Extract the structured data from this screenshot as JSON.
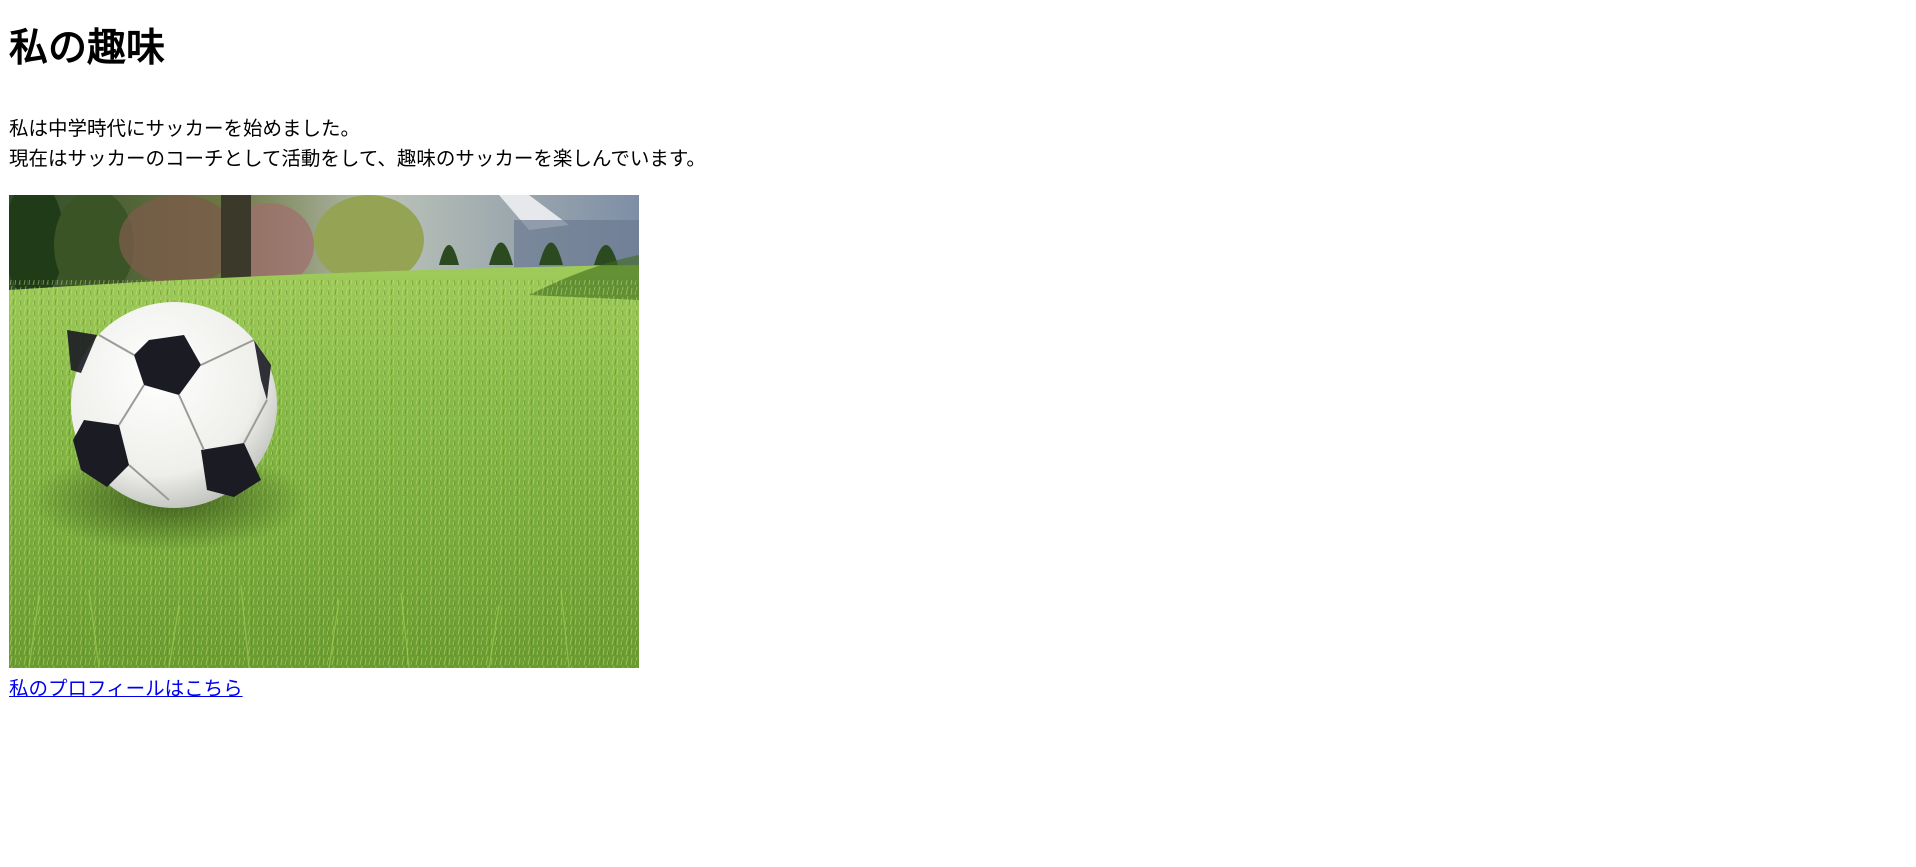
{
  "page": {
    "title": "私の趣味",
    "intro_line_1": "私は中学時代にサッカーを始めました。",
    "intro_line_2": "現在はサッカーのコーチとして活動をして、趣味のサッカーを楽しんでいます。",
    "image_alt": "soccer ball on grass",
    "profile_link_label": "私のプロフィールはこちら"
  },
  "colors": {
    "text": "#000000",
    "link": "#0000ee",
    "background": "#ffffff",
    "grass": "#7fae3e",
    "ball_white": "#f4f4f0",
    "ball_black": "#1b1b24"
  }
}
